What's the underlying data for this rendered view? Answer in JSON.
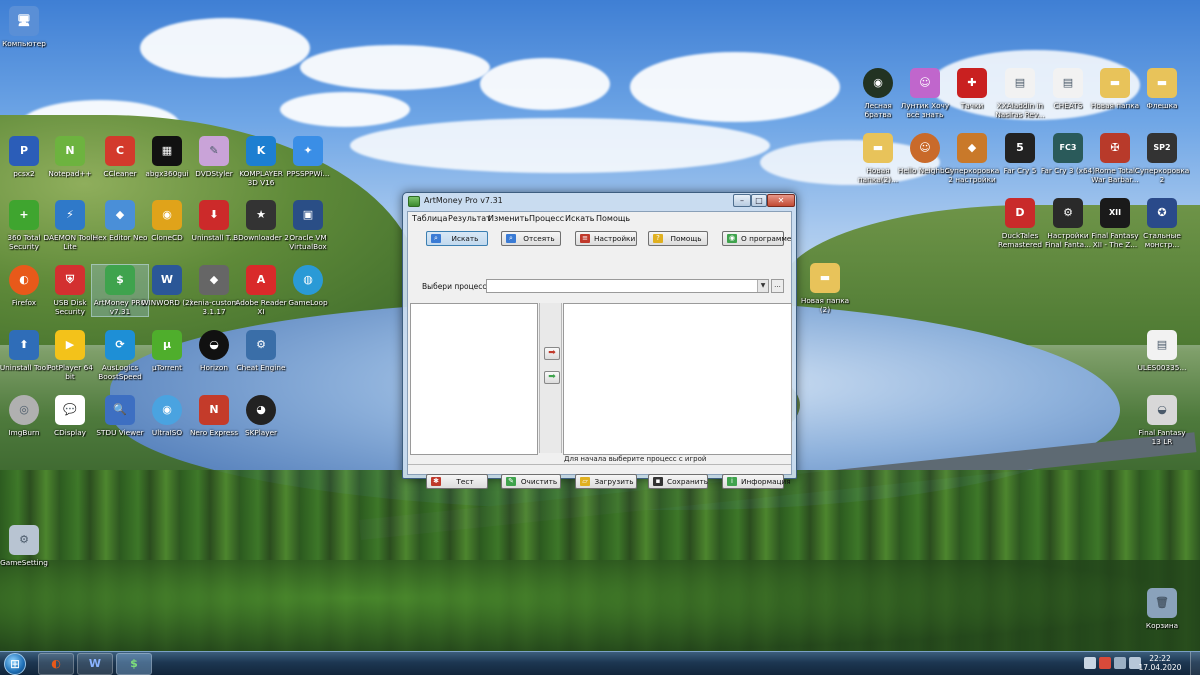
{
  "desktop_icons": [
    {
      "id": "computer",
      "label": "Компьютер",
      "color": "#5a8fd6",
      "glyph": "🖥"
    },
    {
      "id": "pcsx2",
      "label": "pcsx2",
      "color": "#2b5db8",
      "glyph": "P"
    },
    {
      "id": "notepad",
      "label": "Notepad++",
      "color": "#6db33f",
      "glyph": "N"
    },
    {
      "id": "ccleaner",
      "label": "CCleaner",
      "color": "#d33a2c",
      "glyph": "C"
    },
    {
      "id": "abgx",
      "label": "abgx360gui",
      "color": "#111111",
      "glyph": "▦"
    },
    {
      "id": "dvdstyler",
      "label": "DVDStyler",
      "color": "#c9a3d8",
      "glyph": "✎"
    },
    {
      "id": "kmplayer",
      "label": "KOMPLAYER 3D V16",
      "color": "#1d7fd1",
      "glyph": "K"
    },
    {
      "id": "ppsspp",
      "label": "PPSSPPWi...",
      "color": "#3a8ee6",
      "glyph": "✦"
    },
    {
      "id": "360",
      "label": "360 Total Security",
      "color": "#3fa52f",
      "glyph": "+"
    },
    {
      "id": "daemon",
      "label": "DAEMON Tools Lite",
      "color": "#2f79c9",
      "glyph": "⚡"
    },
    {
      "id": "hexeditor",
      "label": "Hex Editor Neo",
      "color": "#4a8fd8",
      "glyph": "◆"
    },
    {
      "id": "clonecd",
      "label": "CloneCD",
      "color": "#e0a31a",
      "glyph": "◉"
    },
    {
      "id": "uninstaller",
      "label": "Uninstall T...",
      "color": "#cc2a2a",
      "glyph": "⬇"
    },
    {
      "id": "bdownloader",
      "label": "BDownloader 2",
      "color": "#333333",
      "glyph": "★"
    },
    {
      "id": "oracle",
      "label": "Oracle VM VirtualBox",
      "color": "#2a4e86",
      "glyph": "▣"
    },
    {
      "id": "firefox",
      "label": "Firefox",
      "color": "#e8591a",
      "glyph": "◐"
    },
    {
      "id": "usbdisk",
      "label": "USB Disk Security",
      "color": "#d33030",
      "glyph": "⛨"
    },
    {
      "id": "artmoney",
      "label": "ArtMoney PRO v7.31",
      "color": "#3fa34d",
      "glyph": "$"
    },
    {
      "id": "winword",
      "label": "WINWORD (2)",
      "color": "#2b5797",
      "glyph": "W"
    },
    {
      "id": "xenia",
      "label": "xenia-custom 3.1.17",
      "color": "#666666",
      "glyph": "◆"
    },
    {
      "id": "adobe",
      "label": "Adobe Reader XI",
      "color": "#d92a2a",
      "glyph": "A"
    },
    {
      "id": "gameloop",
      "label": "GameLoop",
      "color": "#2a9ad6",
      "glyph": "◍"
    },
    {
      "id": "uninstalltool",
      "label": "Uninstall Tool",
      "color": "#2f6db8",
      "glyph": "⬆"
    },
    {
      "id": "potplayer",
      "label": "PotPlayer 64 bit",
      "color": "#f3c21a",
      "glyph": "▶"
    },
    {
      "id": "auslogics",
      "label": "AusLogics BoostSpeed",
      "color": "#1e8fd6",
      "glyph": "⟳"
    },
    {
      "id": "utorrent",
      "label": "µTorrent",
      "color": "#4fae2c",
      "glyph": "µ"
    },
    {
      "id": "horizon",
      "label": "Horizon",
      "color": "#111111",
      "glyph": "◒"
    },
    {
      "id": "cheatengine",
      "label": "Cheat Engine",
      "color": "#3a6ea8",
      "glyph": "⚙"
    },
    {
      "id": "imgburn",
      "label": "ImgBurn",
      "color": "#b0b0b0",
      "glyph": "◎"
    },
    {
      "id": "cdisplay",
      "label": "CDisplay",
      "color": "#ffffff",
      "glyph": "💬"
    },
    {
      "id": "stdu",
      "label": "STDU Viewer",
      "color": "#3d6fc2",
      "glyph": "🔍"
    },
    {
      "id": "ultraiso",
      "label": "UltraISO",
      "color": "#4aa3e0",
      "glyph": "◉"
    },
    {
      "id": "nero",
      "label": "Nero Express",
      "color": "#c43b2a",
      "glyph": "N"
    },
    {
      "id": "skplayer",
      "label": "SKPlayer",
      "color": "#222222",
      "glyph": "◕"
    },
    {
      "id": "gamesetting",
      "label": "GameSetting",
      "color": "#b8c4d2",
      "glyph": "⚙"
    },
    {
      "id": "lesnaya",
      "label": "Лесная братва",
      "color": "#223322",
      "glyph": "◉"
    },
    {
      "id": "luntik",
      "label": "Лунтик Хочу всё знать",
      "color": "#c066cc",
      "glyph": "☺"
    },
    {
      "id": "tachki",
      "label": "Тачки",
      "color": "#c92020",
      "glyph": "✚"
    },
    {
      "id": "xxaladdin",
      "label": "XXAladdin in Nasiras Rev...",
      "color": "#f2f2f2",
      "glyph": "▤"
    },
    {
      "id": "cheats",
      "label": "CHEATS",
      "color": "#f2f2f2",
      "glyph": "▤"
    },
    {
      "id": "newfolder",
      "label": "Новая папка",
      "color": "#e8c35a",
      "glyph": "▬"
    },
    {
      "id": "fleshka",
      "label": "Флешка",
      "color": "#e8c35a",
      "glyph": "▬"
    },
    {
      "id": "novaya_yaichniza",
      "label": "Новая папка(2)...",
      "color": "#e8c35a",
      "glyph": "▬"
    },
    {
      "id": "hello_neighbor",
      "label": "Hello Neighbor",
      "color": "#c96a2a",
      "glyph": "☺"
    },
    {
      "id": "supercow2",
      "label": "Суперкоровка 2 настройки",
      "color": "#c9792a",
      "glyph": "◆"
    },
    {
      "id": "farcry5",
      "label": "Far Cry 5",
      "color": "#222222",
      "glyph": "5"
    },
    {
      "id": "farcry3",
      "label": "Far Cry 3 (x64)",
      "color": "#2a5a5a",
      "glyph": "FC3"
    },
    {
      "id": "rometw",
      "label": "Rome Total War Barbar...",
      "color": "#b83a2a",
      "glyph": "✠"
    },
    {
      "id": "supercow",
      "label": "Суперкоровка 2",
      "color": "#333333",
      "glyph": "SP2"
    },
    {
      "id": "ducktales",
      "label": "DuckTales Remastered",
      "color": "#c92a2a",
      "glyph": "D"
    },
    {
      "id": "ff_settings",
      "label": "Настройки Final Fanta...",
      "color": "#2a2a2a",
      "glyph": "⚙"
    },
    {
      "id": "ff12",
      "label": "Final Fantasy XII - The Z...",
      "color": "#1a1a1a",
      "glyph": "XII"
    },
    {
      "id": "steel",
      "label": "Стальные монстр...",
      "color": "#2a4a8a",
      "glyph": "✪"
    },
    {
      "id": "newfolder2",
      "label": "Новая папка (2)",
      "color": "#e8c35a",
      "glyph": "▬"
    },
    {
      "id": "ules",
      "label": "ULES00335...",
      "color": "#f2f2f2",
      "glyph": "▤"
    },
    {
      "id": "ff13",
      "label": "Final Fantasy 13 LR",
      "color": "#d8d8d8",
      "glyph": "◒"
    },
    {
      "id": "recycle",
      "label": "Корзина",
      "color": "#8aa2bb",
      "glyph": "🗑"
    }
  ],
  "window": {
    "title": "ArtMoney Pro v7.31",
    "controls": {
      "minimize": "–",
      "maximize": "□",
      "close": "✕"
    },
    "menu": [
      "Таблица",
      "Результат",
      "Изменить",
      "Процесс",
      "Искать",
      "Помощь"
    ],
    "toolbar_top": [
      {
        "label": "Искать",
        "icon": "search-icon",
        "color": "#3a7bd5"
      },
      {
        "label": "Отсеять",
        "icon": "filter-icon",
        "color": "#3a7bd5"
      },
      {
        "label": "Настройки",
        "icon": "settings-icon",
        "color": "#c0392b"
      },
      {
        "label": "Помощь",
        "icon": "help-icon",
        "color": "#e0b020"
      },
      {
        "label": "О программе",
        "icon": "about-icon",
        "color": "#3fa34d"
      }
    ],
    "process": {
      "label": "Выбери процесс",
      "value": "",
      "browse": "..."
    },
    "arrows": {
      "to_right": "➡",
      "to_left": "➡"
    },
    "status": "Для начала выберите процесс с игрой",
    "toolbar_bottom": [
      {
        "label": "Тест",
        "icon": "test-icon",
        "color": "#c0392b"
      },
      {
        "label": "Очистить",
        "icon": "clear-icon",
        "color": "#3fa34d"
      },
      {
        "label": "Загрузить",
        "icon": "load-icon",
        "color": "#e0b020"
      },
      {
        "label": "Сохранить",
        "icon": "save-icon",
        "color": "#333333"
      },
      {
        "label": "Информация",
        "icon": "info-icon",
        "color": "#3fa34d"
      }
    ]
  },
  "taskbar": {
    "start_glyph": "⊞",
    "pinned": [
      {
        "name": "firefox",
        "glyph": "◐",
        "color": "#e8591a"
      },
      {
        "name": "word",
        "glyph": "W",
        "color": "#2b5797"
      },
      {
        "name": "artmoney",
        "glyph": "$",
        "color": "#3fa34d"
      }
    ],
    "clock_time": "22:22",
    "clock_date": "17.04.2020"
  }
}
